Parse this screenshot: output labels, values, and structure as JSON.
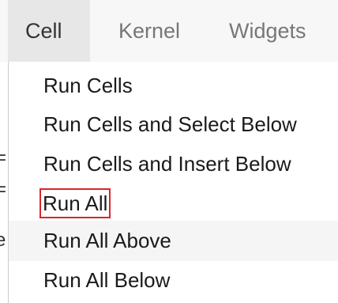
{
  "menubar": {
    "items": [
      {
        "label": "Cell",
        "active": true
      },
      {
        "label": "Kernel",
        "active": false
      },
      {
        "label": "Widgets",
        "active": false
      }
    ]
  },
  "dropdown": {
    "items": [
      {
        "label": "Run Cells"
      },
      {
        "label": "Run Cells and Select Below"
      },
      {
        "label": "Run Cells and Insert Below"
      },
      {
        "label": "Run All",
        "highlighted": true
      },
      {
        "label": "Run All Above",
        "hover": true
      },
      {
        "label": "Run All Below"
      }
    ]
  },
  "highlight_color": "#d8262b"
}
